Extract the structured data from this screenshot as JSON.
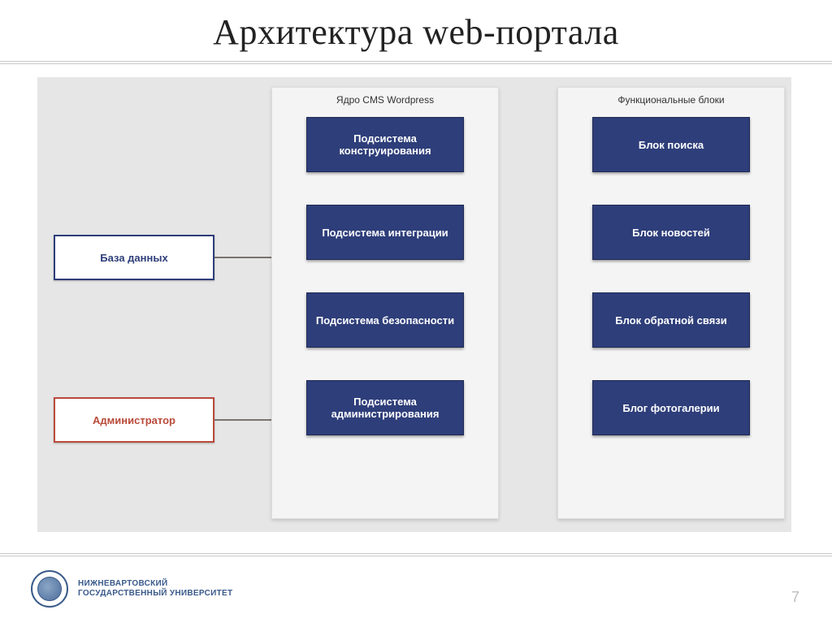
{
  "slide_title": "Архитектура web-портала",
  "actors": {
    "database": "База данных",
    "admin": "Администратор"
  },
  "columns": {
    "core": {
      "title": "Ядро CMS Wordpress",
      "items": [
        "Подсистема конструирования",
        "Подсистема интеграции",
        "Подсистема безопасности",
        "Подсистема администрирования"
      ]
    },
    "functional": {
      "title": "Функциональные блоки",
      "items": [
        "Блок поиска",
        "Блок новостей",
        "Блок обратной связи",
        "Блог фотогалерии"
      ]
    }
  },
  "footer": {
    "line1": "НИЖНЕВАРТОВСКИЙ",
    "line2": "ГОСУДАРСТВЕННЫЙ УНИВЕРСИТЕТ"
  },
  "page_number": "7"
}
